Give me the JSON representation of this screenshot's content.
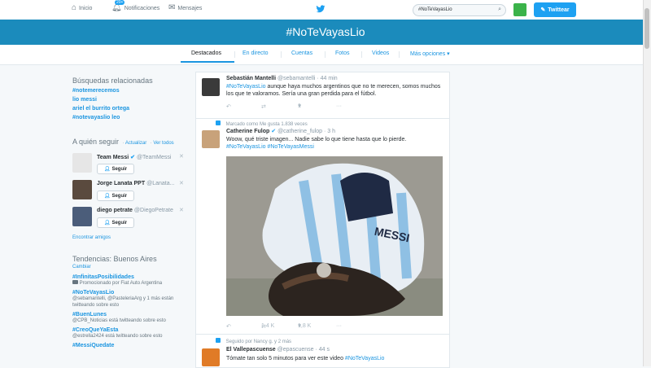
{
  "nav": {
    "home": "Inicio",
    "notifications": "Notificaciones",
    "notifications_badge": "20+",
    "messages": "Mensajes",
    "search_value": "#NoTeVayasLio",
    "tweet_button": "Twittear"
  },
  "banner": {
    "title": "#NoTeVayasLio"
  },
  "tabs": [
    {
      "label": "Destacados"
    },
    {
      "label": "En directo"
    },
    {
      "label": "Cuentas"
    },
    {
      "label": "Fotos"
    },
    {
      "label": "Videos"
    },
    {
      "label": "Más opciones"
    }
  ],
  "related": {
    "title": "Búsquedas relacionadas",
    "items": [
      "#notemerecemos",
      "lio messi",
      "ariel el burrito ortega",
      "#notevayaslio leo"
    ]
  },
  "who_to_follow": {
    "title": "A quién seguir",
    "refresh": "Actualizar",
    "view_all": "Ver todos",
    "follow_label": "Seguir",
    "accounts": [
      {
        "name": "Team Messi",
        "handle": "@TeamMessi"
      },
      {
        "name": "Jorge Lanata PPT",
        "handle": "@Lanata..."
      },
      {
        "name": "diego petrate",
        "handle": "@DiegoPetrate"
      }
    ],
    "find_friends": "Encontrar amigos"
  },
  "trends": {
    "title": "Tendencias: Buenos Aires",
    "change": "Cambiar",
    "items": [
      {
        "name": "#InfinitasPosibilidades",
        "meta": "Promocionado por Fiat Auto Argentina"
      },
      {
        "name": "#NoTeVayasLio",
        "meta": "@sebamantelli, @PasteleriaArg y 1 más están twitteando sobre esto"
      },
      {
        "name": "#BuenLunes",
        "meta": "@CPB_Noticias está twitteando sobre esto"
      },
      {
        "name": "#CreoQueYaEsta",
        "meta": "@estrella2424 está twitteando sobre esto"
      },
      {
        "name": "#MessiQuedate",
        "meta": ""
      }
    ]
  },
  "tweets": [
    {
      "name": "Sebastián Mantelli",
      "handle": "@sebamantelli · 44 min",
      "hashtag": "#NoTeVayasLio",
      "text": " aunque haya muchos argentinos que no te merecen, somos muchos los que te valoramos. Sería una gran perdida para el fútbol.",
      "likes": "1"
    },
    {
      "context": "Marcado como Me gusta 1.838 veces",
      "name": "Catherine Fulop",
      "handle": "@catherine_fulop · 3 h",
      "text": "Woow, qué triste imagen... Nadie sabe lo que tiene hasta que lo pierde.",
      "hashtags": "#NoTeVayasLio #NoTeVayasMessi",
      "retweets": "1,4 K",
      "likes": "1,8 K",
      "jersey_name": "MESSI"
    },
    {
      "context": "Seguido por Nancy g. y 2 más",
      "name": "El Vallepascuense",
      "handle": "@epascuense · 44 s",
      "text": "Tómate tan solo 5 minutos para ver este video ",
      "hashtag": "#NoTeVayasLio"
    }
  ]
}
